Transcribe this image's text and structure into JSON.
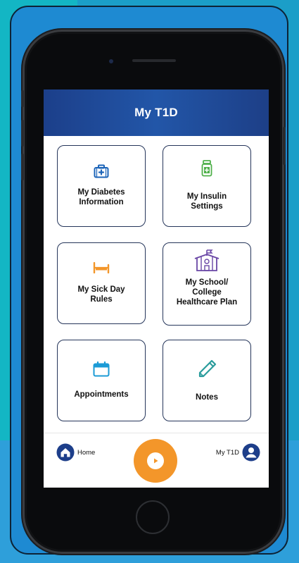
{
  "app": {
    "title": "My T1D"
  },
  "tiles": [
    {
      "label": "My Diabetes\nInformation",
      "icon": "first-aid-kit-icon"
    },
    {
      "label": "My Insulin\nSettings",
      "icon": "insulin-bottle-icon"
    },
    {
      "label": "My Sick Day\nRules",
      "icon": "bed-icon"
    },
    {
      "label": "My School/\nCollege\nHealthcare Plan",
      "icon": "school-building-icon"
    },
    {
      "label": "Appointments",
      "icon": "calendar-icon"
    },
    {
      "label": "Notes",
      "icon": "pencil-icon"
    }
  ],
  "bottom_nav": {
    "home_label": "Home",
    "mine_label": "My T1D",
    "play_icon": "play-icon"
  },
  "colors": {
    "header": "#2256a8",
    "tile_border": "#25355a",
    "accent_orange": "#f3962a",
    "icon_blue": "#1c64b8",
    "icon_green": "#4fb04a",
    "icon_purple": "#6a47a6",
    "icon_teal": "#2a9c9c"
  }
}
